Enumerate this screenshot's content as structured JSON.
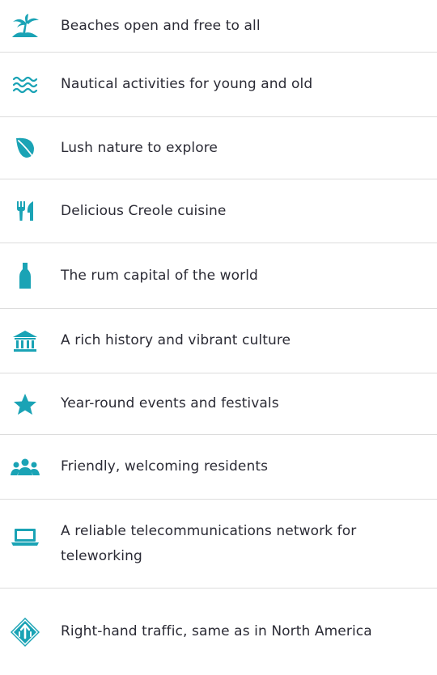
{
  "accent_color": "#1aa3b5",
  "items": [
    {
      "icon": "palm-tree-icon",
      "label": "Beaches open and free to all"
    },
    {
      "icon": "waves-icon",
      "label": "Nautical activities for young and old"
    },
    {
      "icon": "leaf-icon",
      "label": "Lush nature to explore"
    },
    {
      "icon": "fork-knife-icon",
      "label": "Delicious Creole cuisine"
    },
    {
      "icon": "bottle-icon",
      "label": "The rum capital of the world"
    },
    {
      "icon": "museum-icon",
      "label": "A rich history and vibrant culture"
    },
    {
      "icon": "star-icon",
      "label": "Year-round events and festivals"
    },
    {
      "icon": "people-icon",
      "label": "Friendly, welcoming residents"
    },
    {
      "icon": "laptop-icon",
      "label": "A reliable telecommunications network for teleworking"
    },
    {
      "icon": "traffic-sign-icon",
      "label": "Right-hand traffic, same as in North America"
    }
  ]
}
